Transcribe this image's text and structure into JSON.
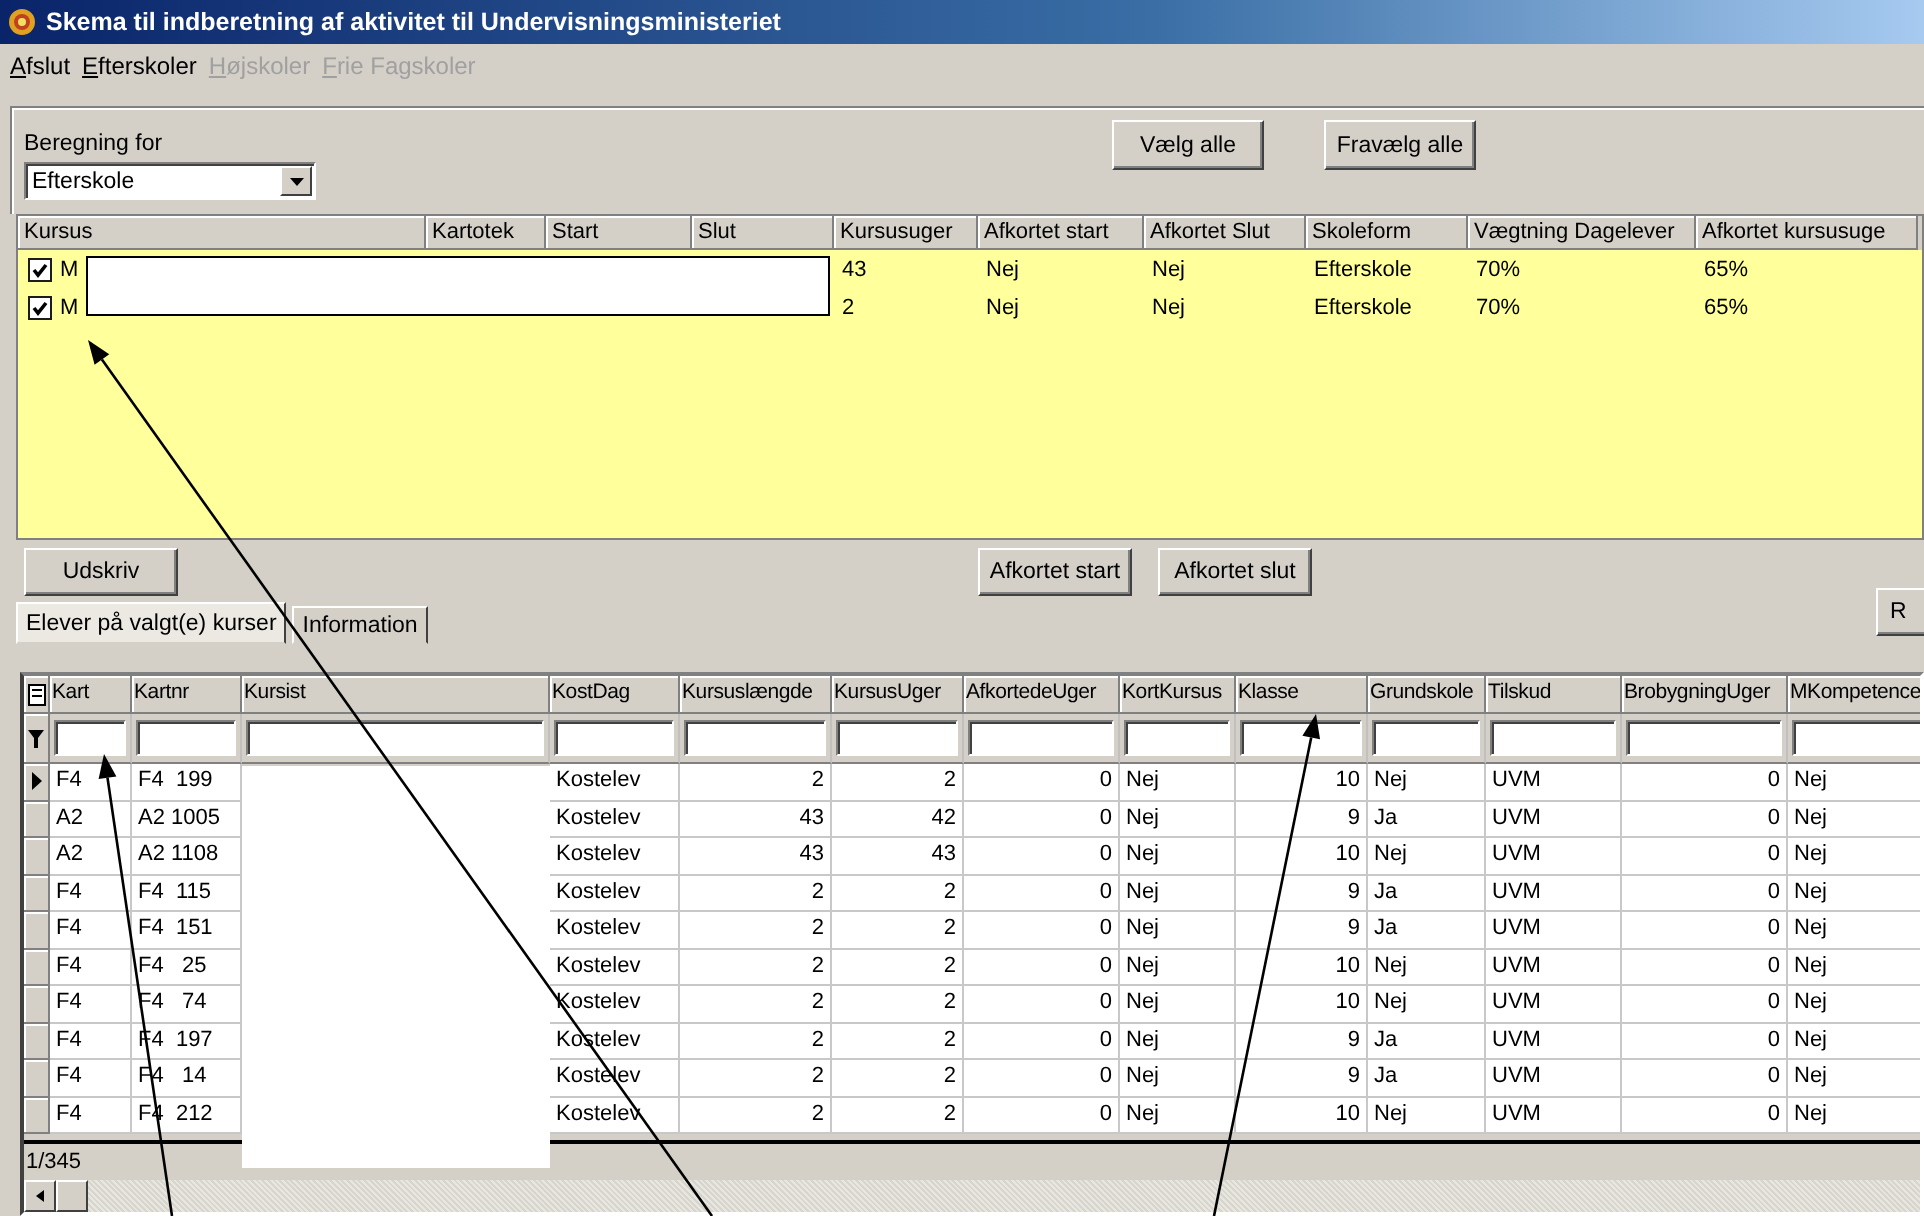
{
  "window": {
    "title": "Skema til indberetning af aktivitet til Undervisningsministeriet"
  },
  "menu": [
    {
      "label": "Afslut",
      "disabled": false
    },
    {
      "label": "Efterskoler",
      "disabled": false
    },
    {
      "label": "Højskoler",
      "disabled": true
    },
    {
      "label": "Frie Fagskoler",
      "disabled": true
    }
  ],
  "beregning": {
    "label": "Beregning for",
    "value": "Efterskole"
  },
  "course_buttons": [
    "Vælg alle",
    "Fravælg alle"
  ],
  "courses": {
    "columns": [
      "Kursus",
      "Kartotek",
      "Start",
      "Slut",
      "Kursusuger",
      "Afkortet start",
      "Afkortet Slut",
      "Skoleform",
      "Vægtning Dagelever",
      "Afkortet kursusuge"
    ],
    "rows": [
      {
        "checked": true,
        "cells": [
          "M",
          "",
          "",
          "",
          "43",
          "Nej",
          "Nej",
          "Efterskole",
          "70%",
          "65%"
        ]
      },
      {
        "checked": true,
        "cells": [
          "M",
          "",
          "",
          "",
          "2",
          "Nej",
          "Nej",
          "Efterskole",
          "70%",
          "65%"
        ]
      }
    ]
  },
  "print_button": "Udskriv",
  "shorten_buttons": [
    "Afkortet start",
    "Afkortet slut"
  ],
  "right_button": "R",
  "tabs": [
    {
      "label": "Elever på valgt(e) kurser",
      "selected": true
    },
    {
      "label": "Information",
      "selected": false
    }
  ],
  "students": {
    "columns": [
      {
        "label": "Kart",
        "kind": "text"
      },
      {
        "label": "Kartnr",
        "kind": "text"
      },
      {
        "label": "Kursist",
        "kind": "text"
      },
      {
        "label": "KostDag",
        "kind": "text"
      },
      {
        "label": "Kursuslængde",
        "kind": "number"
      },
      {
        "label": "KursusUger",
        "kind": "number"
      },
      {
        "label": "AfkortedeUger",
        "kind": "number"
      },
      {
        "label": "KortKursus",
        "kind": "text"
      },
      {
        "label": "Klasse",
        "kind": "number"
      },
      {
        "label": "Grundskole",
        "kind": "text"
      },
      {
        "label": "Tilskud",
        "kind": "text"
      },
      {
        "label": "BrobygningUger",
        "kind": "number"
      },
      {
        "label": "MKompetence",
        "kind": "text"
      }
    ],
    "rows": [
      {
        "selected": true,
        "cells": [
          "F4",
          "F4  199",
          "",
          "Kostelev",
          "2",
          "2",
          "0",
          "Nej",
          "10",
          "Nej",
          "UVM",
          "0",
          "Nej"
        ]
      },
      {
        "selected": false,
        "cells": [
          "A2",
          "A2 1005",
          "",
          "Kostelev",
          "43",
          "42",
          "0",
          "Nej",
          "9",
          "Ja",
          "UVM",
          "0",
          "Nej"
        ]
      },
      {
        "selected": false,
        "cells": [
          "A2",
          "A2 1108",
          "",
          "Kostelev",
          "43",
          "43",
          "0",
          "Nej",
          "10",
          "Nej",
          "UVM",
          "0",
          "Nej"
        ]
      },
      {
        "selected": false,
        "cells": [
          "F4",
          "F4  115",
          "",
          "Kostelev",
          "2",
          "2",
          "0",
          "Nej",
          "9",
          "Ja",
          "UVM",
          "0",
          "Nej"
        ]
      },
      {
        "selected": false,
        "cells": [
          "F4",
          "F4  151",
          "",
          "Kostelev",
          "2",
          "2",
          "0",
          "Nej",
          "9",
          "Ja",
          "UVM",
          "0",
          "Nej"
        ]
      },
      {
        "selected": false,
        "cells": [
          "F4",
          "F4   25",
          "",
          "Kostelev",
          "2",
          "2",
          "0",
          "Nej",
          "10",
          "Nej",
          "UVM",
          "0",
          "Nej"
        ]
      },
      {
        "selected": false,
        "cells": [
          "F4",
          "F4   74",
          "",
          "Kostelev",
          "2",
          "2",
          "0",
          "Nej",
          "10",
          "Nej",
          "UVM",
          "0",
          "Nej"
        ]
      },
      {
        "selected": false,
        "cells": [
          "F4",
          "F4  197",
          "",
          "Kostelev",
          "2",
          "2",
          "0",
          "Nej",
          "9",
          "Ja",
          "UVM",
          "0",
          "Nej"
        ]
      },
      {
        "selected": false,
        "cells": [
          "F4",
          "F4   14",
          "",
          "Kostelev",
          "2",
          "2",
          "0",
          "Nej",
          "9",
          "Ja",
          "UVM",
          "0",
          "Nej"
        ]
      },
      {
        "selected": false,
        "cells": [
          "F4",
          "F4  212",
          "",
          "Kostelev",
          "2",
          "2",
          "0",
          "Nej",
          "10",
          "Nej",
          "UVM",
          "0",
          "Nej"
        ]
      }
    ]
  },
  "status": "1/345"
}
